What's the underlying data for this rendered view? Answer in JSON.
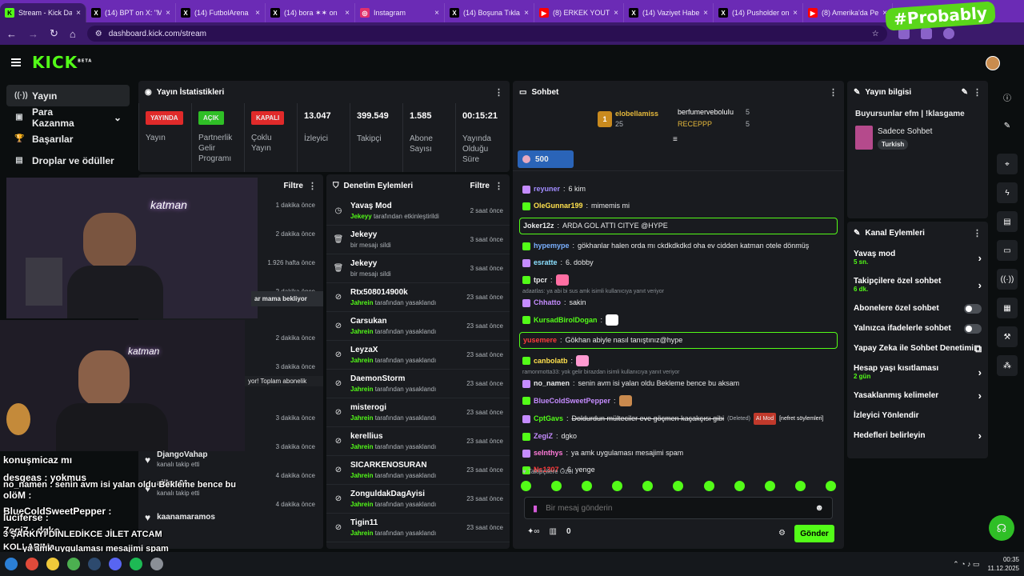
{
  "browser": {
    "tabs": [
      {
        "title": "Stream - Kick Das",
        "color": "#53fc18",
        "glyph": "K"
      },
      {
        "title": "(14) BPT on X: \"M",
        "color": "#000000",
        "glyph": "X"
      },
      {
        "title": "(14) FutbolArena",
        "color": "#000000",
        "glyph": "X"
      },
      {
        "title": "(14) bora ✶✶ on",
        "color": "#000000",
        "glyph": "X"
      },
      {
        "title": "Instagram",
        "color": "#e1306c",
        "glyph": "◎"
      },
      {
        "title": "(14) Boşuna Tıklam",
        "color": "#000000",
        "glyph": "X"
      },
      {
        "title": "(8) ERKEK YOUTUB",
        "color": "#ff0000",
        "glyph": "▶"
      },
      {
        "title": "(14) Vaziyet Haber",
        "color": "#000000",
        "glyph": "X"
      },
      {
        "title": "(14) Pusholder on",
        "color": "#000000",
        "glyph": "X"
      },
      {
        "title": "(8) Amerika'da Pe",
        "color": "#ff0000",
        "glyph": "▶"
      }
    ],
    "url": "dashboard.kick.com/stream",
    "watermark": "#Probably"
  },
  "sidebar": {
    "items": [
      {
        "label": "Yayın",
        "icon": "broadcast-icon"
      },
      {
        "label": "Para Kazanma",
        "icon": "money-icon"
      },
      {
        "label": "Başarılar",
        "icon": "trophy-icon"
      },
      {
        "label": "Droplar ve ödüller",
        "icon": "gift-icon"
      }
    ]
  },
  "stats": {
    "title": "Yayın İstatistikleri",
    "items": [
      {
        "badge": "YAYINDA",
        "badge_color": "#e02a2a",
        "label": "Yayın"
      },
      {
        "badge": "AÇIK",
        "badge_color": "#2fbf26",
        "label": "Partnerlik Gelir Programı"
      },
      {
        "badge": "KAPALI",
        "badge_color": "#e02a2a",
        "label": "Çoklu Yayın"
      },
      {
        "value": "13.047",
        "label": "İzleyici"
      },
      {
        "value": "399.549",
        "label": "Takipçi"
      },
      {
        "value": "1.585",
        "label": "Abone Sayısı"
      },
      {
        "value": "00:15:21",
        "label": "Yayında Olduğu Süre"
      }
    ]
  },
  "activity": {
    "filter": "Filtre",
    "times": [
      "1 dakika önce",
      "2 dakika önce",
      "1.926 hafta önce",
      "2 dakika önce",
      "2 dakika önce",
      "3 dakika önce",
      "3 dakika önce",
      "3 dakika önce",
      "4 dakika önce",
      "4 dakika önce"
    ],
    "rows": [
      {
        "name": "DjangoVahap",
        "sub": "kanalı takip etti"
      },
      {
        "name": "aiikse01",
        "sub": "kanalı takip etti"
      },
      {
        "name": "kaanamaramos",
        "sub": ""
      }
    ],
    "snippets": [
      "ar mama bekliyor",
      "yor! Toplam abonelik"
    ]
  },
  "moderation": {
    "title": "Denetim Eylemleri",
    "filter": "Filtre",
    "rows": [
      {
        "name": "Yavaş Mod",
        "by": "Jekeyy",
        "action": "tarafından etkinleştirildi",
        "time": "2 saat önce",
        "icon": "slow-mode-icon"
      },
      {
        "name": "Jekeyy",
        "by": "",
        "action": "bir mesajı sildi",
        "time": "3 saat önce",
        "icon": "trash-icon"
      },
      {
        "name": "Jekeyy",
        "by": "",
        "action": "bir mesajı sildi",
        "time": "3 saat önce",
        "icon": "trash-icon"
      },
      {
        "name": "Rtx508014900k",
        "by": "Jahrein",
        "action": "tarafından yasaklandı",
        "time": "23 saat önce",
        "icon": "ban-icon"
      },
      {
        "name": "Carsukan",
        "by": "Jahrein",
        "action": "tarafından yasaklandı",
        "time": "23 saat önce",
        "icon": "ban-icon"
      },
      {
        "name": "LeyzaX",
        "by": "Jahrein",
        "action": "tarafından yasaklandı",
        "time": "23 saat önce",
        "icon": "ban-icon"
      },
      {
        "name": "DaemonStorm",
        "by": "Jahrein",
        "action": "tarafından yasaklandı",
        "time": "23 saat önce",
        "icon": "ban-icon"
      },
      {
        "name": "misterogi",
        "by": "Jahrein",
        "action": "tarafından yasaklandı",
        "time": "23 saat önce",
        "icon": "ban-icon"
      },
      {
        "name": "kerellius",
        "by": "Jahrein",
        "action": "tarafından yasaklandı",
        "time": "23 saat önce",
        "icon": "ban-icon"
      },
      {
        "name": "SICARKENOSURAN",
        "by": "Jahrein",
        "action": "tarafından yasaklandı",
        "time": "23 saat önce",
        "icon": "ban-icon"
      },
      {
        "name": "ZonguldakDagAyisi",
        "by": "Jahrein",
        "action": "tarafından yasaklandı",
        "time": "23 saat önce",
        "icon": "ban-icon"
      },
      {
        "name": "Tigin11",
        "by": "Jahrein",
        "action": "tarafından yasaklandı",
        "time": "23 saat önce",
        "icon": "ban-icon"
      }
    ]
  },
  "chat": {
    "title": "Sohbet",
    "leaders": [
      {
        "name": "elobellamiss",
        "amount": "25"
      },
      {
        "name": "berfumerveboluIu",
        "amount": "5"
      },
      {
        "name": "RECEPPP",
        "amount": "5"
      }
    ],
    "rank": "1",
    "pinned_amount": "500",
    "messages": [
      {
        "user": "reyuner",
        "color": "#a18cff",
        "text": "6 kim"
      },
      {
        "user": "OleGunnar199",
        "color": "#ffe14d",
        "text": "mimemis mi"
      },
      {
        "user": "Joker12z",
        "color": "#e9eaeb",
        "text": "ARDA GOL ATTI CITYE @HYPE",
        "highlight": true
      },
      {
        "user": "hypemype",
        "color": "#7ab0ff",
        "text": "gökhanlar halen orda mı ckdkdkdkd oha ev cidden katman otele dönmüş"
      },
      {
        "user": "esratte",
        "color": "#8ce0ff",
        "text": "6. dobby"
      },
      {
        "user": "tpcr",
        "color": "#e9eaeb",
        "text": ""
      },
      {
        "user": "Chhatto",
        "color": "#c58cff",
        "text": "sakin",
        "reply": "adaatlas: ya abi bi sus amk isimli kullanıcıya yanıt veriyor"
      },
      {
        "user": "KursadBirolDogan",
        "color": "#53fc18",
        "text": ""
      },
      {
        "user": "yusemere",
        "color": "#ff3b3b",
        "text": "Gökhan abiyle nasıl tanıştınız@hype",
        "highlight": true
      },
      {
        "user": "canbolatb",
        "color": "#ffe14d",
        "text": ""
      },
      {
        "user": "no_namen",
        "color": "#e9eaeb",
        "text": "senin avm isi yalan oldu Bekleme bence bu aksam",
        "reply": "ramonmotta33: yok gelir birazdan isimli kullanıcıya yanıt veriyor"
      },
      {
        "user": "BlueColdSweetPepper",
        "color": "#c58cff",
        "text": ""
      },
      {
        "user": "CptGavs",
        "color": "#53fc18",
        "text": "Doldurdun mülteciler eve göçmen kaçakçısı gibi",
        "deleted": "(Deleted)",
        "tag": "AI Mod",
        "tag2": "[nefret söylemleri]"
      },
      {
        "user": "ZegiZ",
        "color": "#c58cff",
        "text": "dgko"
      },
      {
        "user": "seInthys",
        "color": "#ff7ad9",
        "text": "ya amk uygulaması mesajimi spam"
      },
      {
        "user": "Ns1307",
        "color": "#ff3b3b",
        "text": "6. yenge"
      }
    ],
    "followers_only": "Takipçilere Özel",
    "placeholder": "Bir mesaj gönderin",
    "count": "0",
    "send": "Gönder"
  },
  "info": {
    "title": "Yayın bilgisi",
    "stream_title": "Buyursunlar efm | !klasgame",
    "category": "Sadece Sohbet",
    "tag": "Turkish"
  },
  "channel_actions": {
    "title": "Kanal Eylemleri",
    "items": [
      {
        "label": "Yavaş mod",
        "sub": "5 sn.",
        "ctrl": "arrow"
      },
      {
        "label": "Takipçilere özel sohbet",
        "sub": "6 dk.",
        "ctrl": "arrow"
      },
      {
        "label": "Abonelere özel sohbet",
        "sub": "",
        "ctrl": "toggle"
      },
      {
        "label": "Yalnızca ifadelerle sohbet",
        "sub": "",
        "ctrl": "toggle"
      },
      {
        "label": "Yapay Zeka ile Sohbet Denetimi",
        "sub": "",
        "ctrl": "external"
      },
      {
        "label": "Hesap yaşı kısıtlaması",
        "sub": "2 gün",
        "ctrl": "arrow"
      },
      {
        "label": "Yasaklanmış kelimeler",
        "sub": "",
        "ctrl": "arrow"
      },
      {
        "label": "İzleyici Yönlendir",
        "sub": "",
        "ctrl": "none"
      },
      {
        "label": "Hedefleri belirleyin",
        "sub": "",
        "ctrl": "arrow"
      }
    ]
  },
  "overlay": {
    "cam_sign": "katman",
    "lines": [
      "konuşmicaz mı",
      "desgeas : yokmus",
      "no_namen : senin avm isi yalan oldu Bekleme bence bu",
      "olöM :",
      "BlueColdSweetPepper :",
      "luciferse :",
      "Zegi7 : dgko",
      "3 ŞARKIYI DİNLEDİKCE JİLET ATCAM",
      "KOLLARIMa",
      "ya amk uygulaması mesajimi spam",
      "6. yenge"
    ]
  },
  "taskbar": {
    "time": "00:35",
    "date": "11.12.2025"
  }
}
